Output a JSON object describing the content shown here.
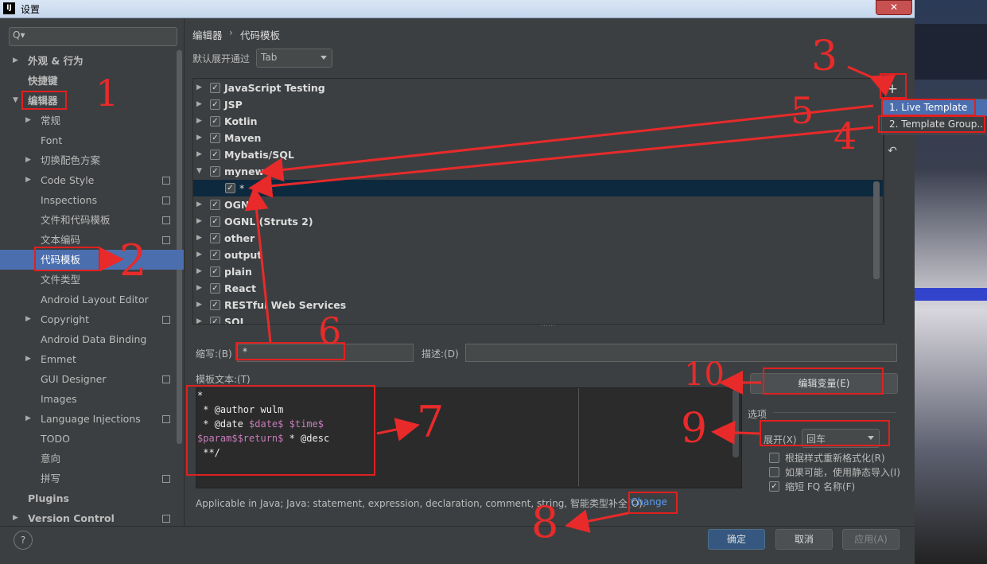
{
  "window": {
    "title": "设置",
    "app_icon": "IJ",
    "close_glyph": "✕"
  },
  "search": {
    "icon": "search-icon",
    "glyph": "Q▾",
    "placeholder": ""
  },
  "sidebar": {
    "items": [
      {
        "label": "外观 & 行为"
      },
      {
        "label": "快捷键"
      },
      {
        "label": "编辑器"
      },
      {
        "label": "常规"
      },
      {
        "label": "Font"
      },
      {
        "label": "切换配色方案"
      },
      {
        "label": "Code Style"
      },
      {
        "label": "Inspections"
      },
      {
        "label": "文件和代码模板"
      },
      {
        "label": "文本编码"
      },
      {
        "label": "代码模板"
      },
      {
        "label": "文件类型"
      },
      {
        "label": "Android Layout Editor"
      },
      {
        "label": "Copyright"
      },
      {
        "label": "Android Data Binding"
      },
      {
        "label": "Emmet"
      },
      {
        "label": "GUI Designer"
      },
      {
        "label": "Images"
      },
      {
        "label": "Language Injections"
      },
      {
        "label": "TODO"
      },
      {
        "label": "意向"
      },
      {
        "label": "拼写"
      },
      {
        "label": "Plugins"
      },
      {
        "label": "Version Control"
      }
    ]
  },
  "breadcrumb": {
    "parent": "编辑器",
    "separator": "›",
    "current": "代码模板"
  },
  "expand_default": {
    "label": "默认展开通过",
    "value": "Tab"
  },
  "template_groups": [
    {
      "name": "JavaScript Testing",
      "checked": true
    },
    {
      "name": "JSP",
      "checked": true
    },
    {
      "name": "Kotlin",
      "checked": true
    },
    {
      "name": "Maven",
      "checked": true
    },
    {
      "name": "Mybatis/SQL",
      "checked": true
    },
    {
      "name": "mynew",
      "checked": true
    },
    {
      "name": "*",
      "checked": true
    },
    {
      "name": "OGNL",
      "checked": true
    },
    {
      "name": "OGNL (Struts 2)",
      "checked": true
    },
    {
      "name": "other",
      "checked": true
    },
    {
      "name": "output",
      "checked": true
    },
    {
      "name": "plain",
      "checked": true
    },
    {
      "name": "React",
      "checked": true
    },
    {
      "name": "RESTful Web Services",
      "checked": true
    },
    {
      "name": "SQL",
      "checked": true
    }
  ],
  "toolbar": {
    "add_glyph": "+",
    "undo_glyph": "↶",
    "check_glyph": "✓"
  },
  "add_menu": {
    "live_template": "1. Live Template",
    "template_group": "2. Template Group..."
  },
  "abbreviation": {
    "label": "缩写:(B)",
    "value": "*"
  },
  "description": {
    "label": "描述:(D)",
    "value": ""
  },
  "template_text": {
    "label": "模板文本:(T)",
    "line1": "*",
    "line2": " * @author wulm",
    "line3_prefix": " * @date ",
    "line3_var1": "$date$",
    "line3_mid": " ",
    "line3_var2": "$time$",
    "line4_var1": "$param$",
    "line4_var2": "$return$",
    "line4_suffix": " * @desc",
    "line5": " **/"
  },
  "edit_variables_label": "编辑变量(E)",
  "options": {
    "label": "选项",
    "expand_with_label": "展开(X)",
    "expand_with_value": "回车",
    "reformat": "根据样式重新格式化(R)",
    "static_import": "如果可能，使用静态导入(I)",
    "shorten_fq": "缩短 FQ 名称(F)"
  },
  "applicable": {
    "text": "Applicable in Java; Java: statement, expression, declaration, comment, string, 智能类型补全(O).",
    "link": "Change"
  },
  "buttons": {
    "ok": "确定",
    "cancel": "取消",
    "apply": "应用(A)",
    "help": "?"
  },
  "annotations": [
    "1",
    "2",
    "3",
    "4",
    "5",
    "6",
    "7",
    "8",
    "9",
    "10"
  ],
  "colors": {
    "accent": "#4b6eaf",
    "annotation": "#e02020",
    "link": "#589df6",
    "template_var": "#c77dbb"
  }
}
